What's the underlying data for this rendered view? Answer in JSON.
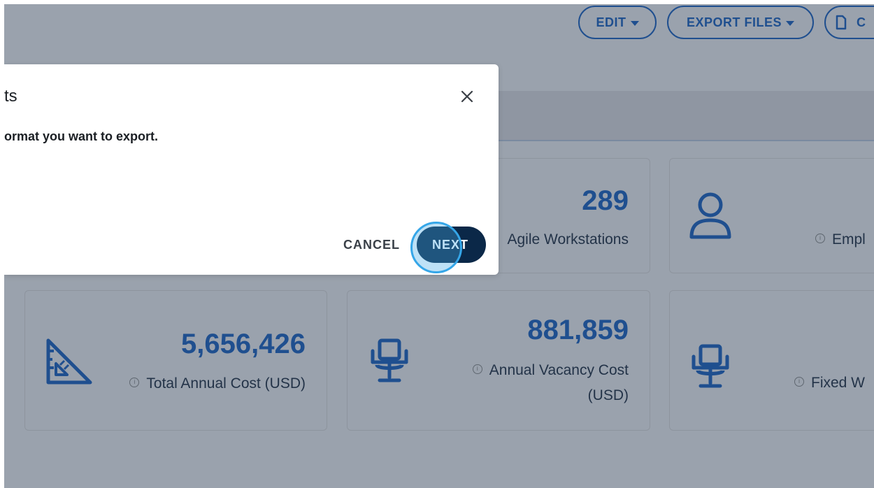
{
  "toolbar": {
    "edit_label": "EDIT",
    "export_files_label": "EXPORT FILES",
    "third_label": "C"
  },
  "dialog": {
    "title": "ts",
    "message": "ormat you want to export.",
    "cancel_label": "CANCEL",
    "next_label": "NEXT"
  },
  "kpis": {
    "agile": {
      "value": "289",
      "label": "Agile Workstations"
    },
    "employees": {
      "label": "Empl"
    },
    "total_cost": {
      "value": "5,656,426",
      "label": "Total Annual Cost (USD)"
    },
    "vacancy_cost": {
      "value": "881,859",
      "label_line1": "Annual Vacancy Cost",
      "label_line2": "(USD)"
    },
    "fixed": {
      "label": "Fixed W"
    }
  },
  "colors": {
    "overlay_bg": "#9aa2ad",
    "accent_blue": "#1f4f8f",
    "next_button": "#0b2848",
    "click_highlight": "#35a6e8"
  },
  "icons": [
    "caret-down-icon",
    "document-icon",
    "close-icon",
    "user-icon",
    "ruler-triangle-icon",
    "office-chair-icon",
    "info-icon"
  ]
}
